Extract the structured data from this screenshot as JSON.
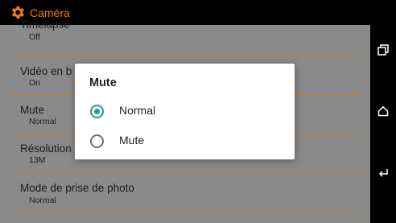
{
  "app": {
    "title": "Caméra"
  },
  "settings": [
    {
      "title": "Timelapse",
      "value": "Off"
    },
    {
      "title": "Vidéo en b",
      "value": "On"
    },
    {
      "title": "Mute",
      "value": "Normal"
    },
    {
      "title": "Résolution",
      "value": "13M"
    },
    {
      "title": "Mode de prise de photo",
      "value": "Normal"
    }
  ],
  "dialog": {
    "title": "Mute",
    "options": [
      {
        "label": "Normal",
        "selected": true
      },
      {
        "label": "Mute",
        "selected": false
      }
    ]
  },
  "colors": {
    "accent": "#f07c12",
    "radio_selected": "#1f9e8b",
    "divider": "#c47a3a",
    "dimmed_background": "#8a8a8a"
  },
  "nav": {
    "icons": [
      "recent-apps-icon",
      "home-icon",
      "back-icon"
    ]
  }
}
